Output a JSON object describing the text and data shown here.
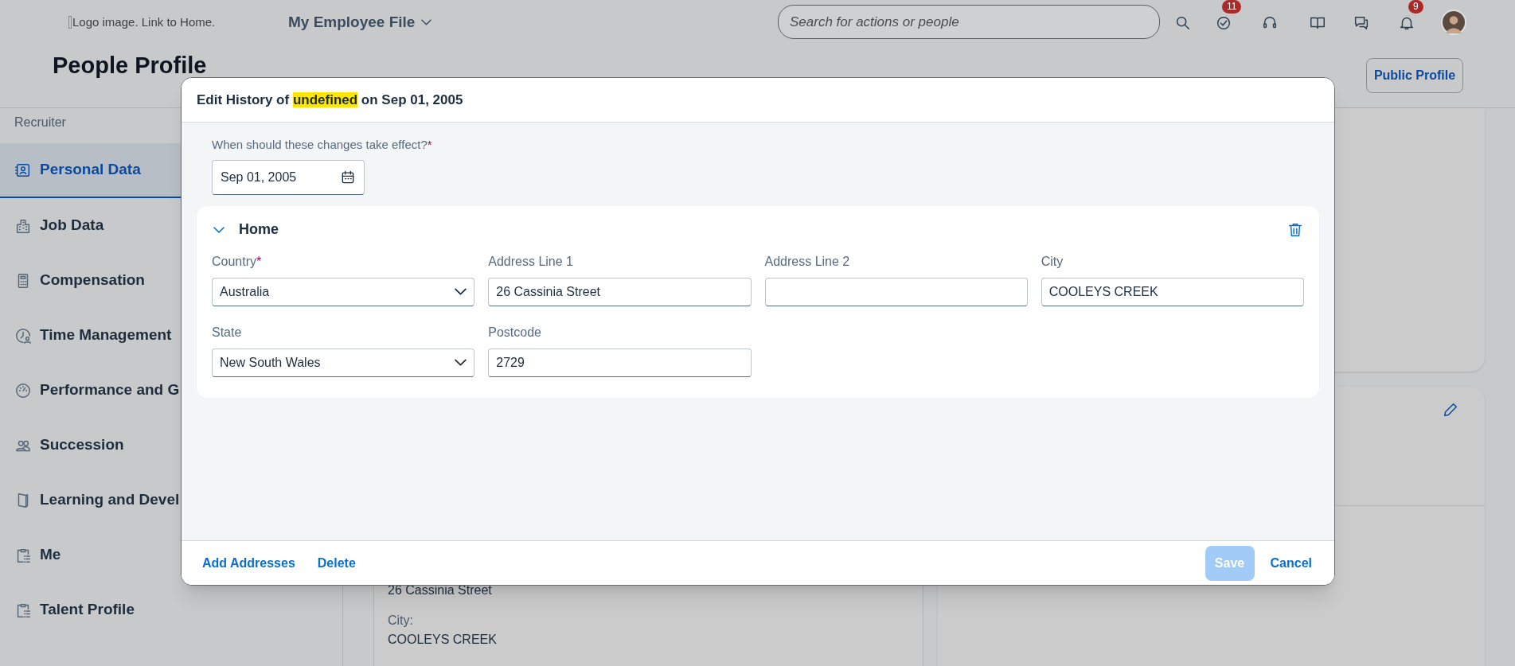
{
  "header": {
    "logo_alt": "Logo image. Link to Home.",
    "app_menu": "My Employee File",
    "search": {
      "placeholder": "Search for actions or people"
    },
    "actions": [
      {
        "kind": "search"
      },
      {
        "kind": "todo",
        "badge": "11"
      },
      {
        "kind": "support"
      },
      {
        "kind": "guide"
      },
      {
        "kind": "feedback"
      },
      {
        "kind": "notifications",
        "badge": "9"
      },
      {
        "kind": "avatar"
      }
    ]
  },
  "page_title": "People Profile",
  "public_profile_button": "Public Profile",
  "sidebar": {
    "heading": "Recruiter",
    "items": [
      {
        "label": "Personal Data",
        "kind": "person",
        "selected": true
      },
      {
        "label": "Job Data",
        "kind": "building",
        "selected": false
      },
      {
        "label": "Compensation",
        "kind": "calculator",
        "selected": false
      },
      {
        "label": "Time Management",
        "kind": "clock",
        "selected": false
      },
      {
        "label": "Performance and G",
        "kind": "gauge",
        "selected": false
      },
      {
        "label": "Succession",
        "kind": "people",
        "selected": false
      },
      {
        "label": "Learning and Devel",
        "kind": "book",
        "selected": false
      },
      {
        "label": "Me",
        "kind": "clipboard",
        "selected": false
      },
      {
        "label": "Talent Profile",
        "kind": "clipboard",
        "selected": false
      }
    ]
  },
  "background_card": {
    "lines": [
      {
        "kind": "value",
        "text": "26 Cassinia Street"
      },
      {
        "kind": "label",
        "text": "City:"
      },
      {
        "kind": "value",
        "text": "COOLEYS CREEK"
      }
    ]
  },
  "dialog": {
    "title_before": "Edit History of",
    "highlighted": "undefined",
    "title_after": "on Sep 01, 2005",
    "effective_date": {
      "label": "When should these changes take effect?",
      "required_mark": "*",
      "value": "Sep 01, 2005"
    },
    "section": {
      "title": "Home",
      "expanded": true,
      "fields": [
        {
          "label": "Country",
          "required_mark": "*",
          "kind": "select",
          "value": "Australia"
        },
        {
          "label": "Address Line 1",
          "kind": "text",
          "value": "26 Cassinia Street"
        },
        {
          "label": "Address Line 2",
          "kind": "text"
        },
        {
          "label": "City",
          "kind": "text",
          "value": "COOLEYS CREEK"
        },
        {
          "label": "State",
          "kind": "select",
          "value": "New South Wales"
        },
        {
          "label": "Postcode",
          "kind": "text",
          "value": "2729"
        }
      ]
    },
    "footer": {
      "left_buttons": [
        "Add Addresses",
        "Delete"
      ],
      "save": {
        "label": "Save",
        "disabled": true
      },
      "cancel": "Cancel"
    }
  }
}
